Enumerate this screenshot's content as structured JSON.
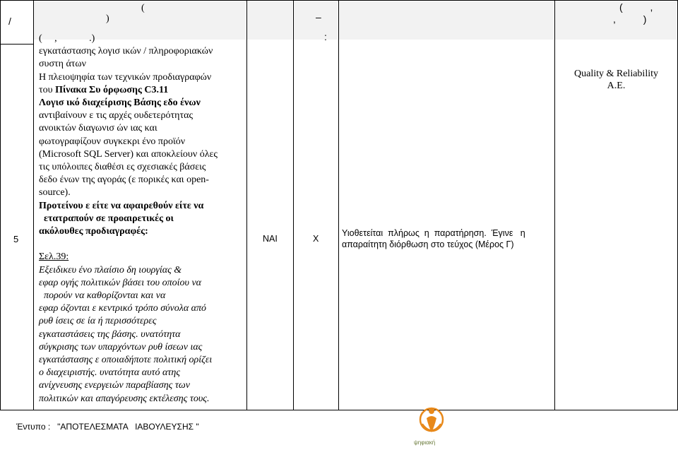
{
  "header": {
    "fragments": [
      {
        "id": "h-slash",
        "text": "/"
      },
      {
        "id": "h-paren1",
        "text": "("
      },
      {
        "id": "h-paren2",
        "text": ")"
      },
      {
        "id": "h-dash",
        "text": "–"
      },
      {
        "id": "h-colon",
        "text": ":"
      },
      {
        "id": "h-right1",
        "text": "(          ,"
      },
      {
        "id": "h-right2",
        "text": ",          )"
      }
    ],
    "subline": "(     ,             .)"
  },
  "row": {
    "number": "5",
    "observation": {
      "p1_lines": [
        "εγκατάστασης λογισ ικών / πληροφοριακών",
        "συστη άτων",
        "Η πλειοψηφία των  τεχνικών προδιαγραφών"
      ],
      "p1_table_prefix": "του ",
      "p1_table_bold": "Πίνακα Συ   όρφωσης C3.11",
      "p1_bold_line": "Λογισ ικό   διαχείρισης Βάσης  εδο ένων",
      "p1_rest_lines": [
        "αντιβαίνουν   ε τις αρχές ουδετερότητας",
        "ανοικτών διαγωνισ ών  ιας και",
        "φωτογραφίζουν συγκεκρι ένο προϊόν",
        "(Microsoft SQL Server) και αποκλείουν όλες",
        "τις υπόλοιπες διαθέσι ες σχεσιακές βάσεις",
        "δεδο ένων της αγοράς (ε πορικές και open-",
        "source)."
      ],
      "p2_bold_lines": [
        "Προτείνου  ε είτε να αφαιρεθούν είτε να",
        "  ετατραπούν σε προαιρετικές οι",
        "ακόλουθες προδιαγραφές:"
      ],
      "p3_ref": "Σελ.39:",
      "p3_italic_lines": [
        "Εξειδικευ ένο πλαίσιο δη ιουργίας &",
        "εφαρ ογής πολιτικών βάσει του οποίου να",
        "  πορούν να καθορίζονται και να",
        "εφαρ όζονται  ε κεντρικό τρόπο σύνολα από",
        "ρυθ ίσεις σε  ία ή περισσότερες",
        "εγκαταστάσεις της βάσης.   υνατότητα",
        "σύγκρισης των υπαρχόντων ρυθ ίσεων   ιας",
        "εγκατάστασης  ε οποιαδήποτε πολιτική ορίζει",
        "ο διαχειριστής.   υνατότητα αυτό ατης",
        "ανίχνευσης ενεργειών παραβίασης των",
        "πολιτικών και απαγόρευσης εκτέλεσης τους."
      ]
    },
    "accepted": "ΝΑΙ",
    "mark": "Χ",
    "response_line1": "Υιοθετείται  πλήρως  η  παρατήρηση.  Έγινε   η",
    "response_line2": "απαραίτητη διόρθωση στο τεύχος (Μέρος Γ)",
    "participant_line1": "Quality & Reliability",
    "participant_line2": "Α.Ε."
  },
  "footer": {
    "form_label": "Έντυπο :   \"ΑΠΟΤΕΛΕΣΜΑΤΑ   ΙΑΒΟΥΛΕΥΣΗΣ \"",
    "logo_text": "ψηφιακή"
  },
  "colors": {
    "header_fill": "#f2f2f2",
    "logo_orange": "#e8891a",
    "logo_text": "#6a7a3a"
  }
}
